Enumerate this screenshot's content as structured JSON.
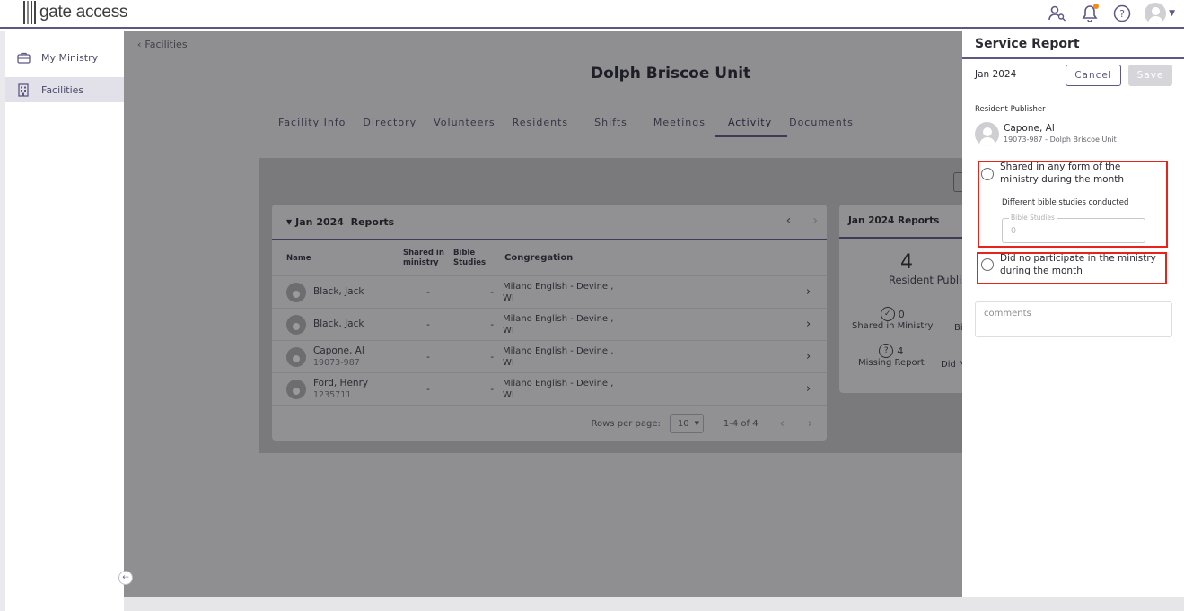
{
  "app": {
    "logo_text": "gate access"
  },
  "topbar": {
    "icons": [
      "user-search-icon",
      "bell-icon",
      "help-icon",
      "account-icon",
      "chevron-down-icon"
    ],
    "notification_dot_color": "#f28b1d"
  },
  "sidebar": {
    "items": [
      {
        "label": "My Ministry",
        "icon": "briefcase-icon",
        "active": false
      },
      {
        "label": "Facilities",
        "icon": "building-icon",
        "active": true
      }
    ]
  },
  "breadcrumb": {
    "back_label": "Facilities"
  },
  "page": {
    "title": "Dolph Briscoe Unit"
  },
  "tabs": [
    {
      "label": "Facility Info"
    },
    {
      "label": "Directory"
    },
    {
      "label": "Volunteers"
    },
    {
      "label": "Residents"
    },
    {
      "label": "Shifts"
    },
    {
      "label": "Meetings"
    },
    {
      "label": "Activity",
      "active": true
    },
    {
      "label": "Documents"
    }
  ],
  "reports_table": {
    "header_title": "Jan 2024  Reports",
    "columns": {
      "name": "Name",
      "shared": "Shared in ministry",
      "bible": "Bible Studies",
      "congregation": "Congregation"
    },
    "rows": [
      {
        "name": "Black, Jack",
        "sub": "",
        "shared": "-",
        "bible": "-",
        "congregation": "Milano English - Devine , WI"
      },
      {
        "name": "Black, Jack",
        "sub": "",
        "shared": "-",
        "bible": "-",
        "congregation": "Milano English - Devine , WI"
      },
      {
        "name": "Capone, Al",
        "sub": "19073-987",
        "shared": "-",
        "bible": "-",
        "congregation": "Milano English - Devine , WI"
      },
      {
        "name": "Ford, Henry",
        "sub": "1235711",
        "shared": "-",
        "bible": "-",
        "congregation": "Milano English - Devine , WI"
      }
    ],
    "pager": {
      "rows_per_page_label": "Rows per page:",
      "rows_per_page": "10",
      "range": "1-4 of 4"
    }
  },
  "summary_card": {
    "title": "Jan 2024 Reports",
    "total": "4",
    "total_label": "Resident Publis",
    "stats": [
      {
        "value": "0",
        "label": "Shared in Ministry",
        "icon": "check-circle-icon"
      },
      {
        "value": "",
        "label": "Bi",
        "icon": ""
      },
      {
        "value": "4",
        "label": "Missing Report",
        "icon": "question-circle-icon"
      },
      {
        "value": "",
        "label": "Did N",
        "icon": ""
      }
    ]
  },
  "drawer": {
    "title": "Service Report",
    "month": "Jan 2024",
    "cancel_label": "Cancel",
    "save_label": "Save",
    "resident_publisher_label": "Resident Publisher",
    "publisher_name": "Capone, Al",
    "publisher_sub": "19073-987 - Dolph Briscoe Unit",
    "option_shared": "Shared in any form of the ministry during the month",
    "bible_studies_heading": "Different bible studies conducted",
    "bible_studies_field_label": "Bible Studies",
    "bible_studies_value": "0",
    "option_none": "Did no participate in the ministry during the month",
    "comments_placeholder": "comments",
    "highlight_color": "#e8231c"
  }
}
